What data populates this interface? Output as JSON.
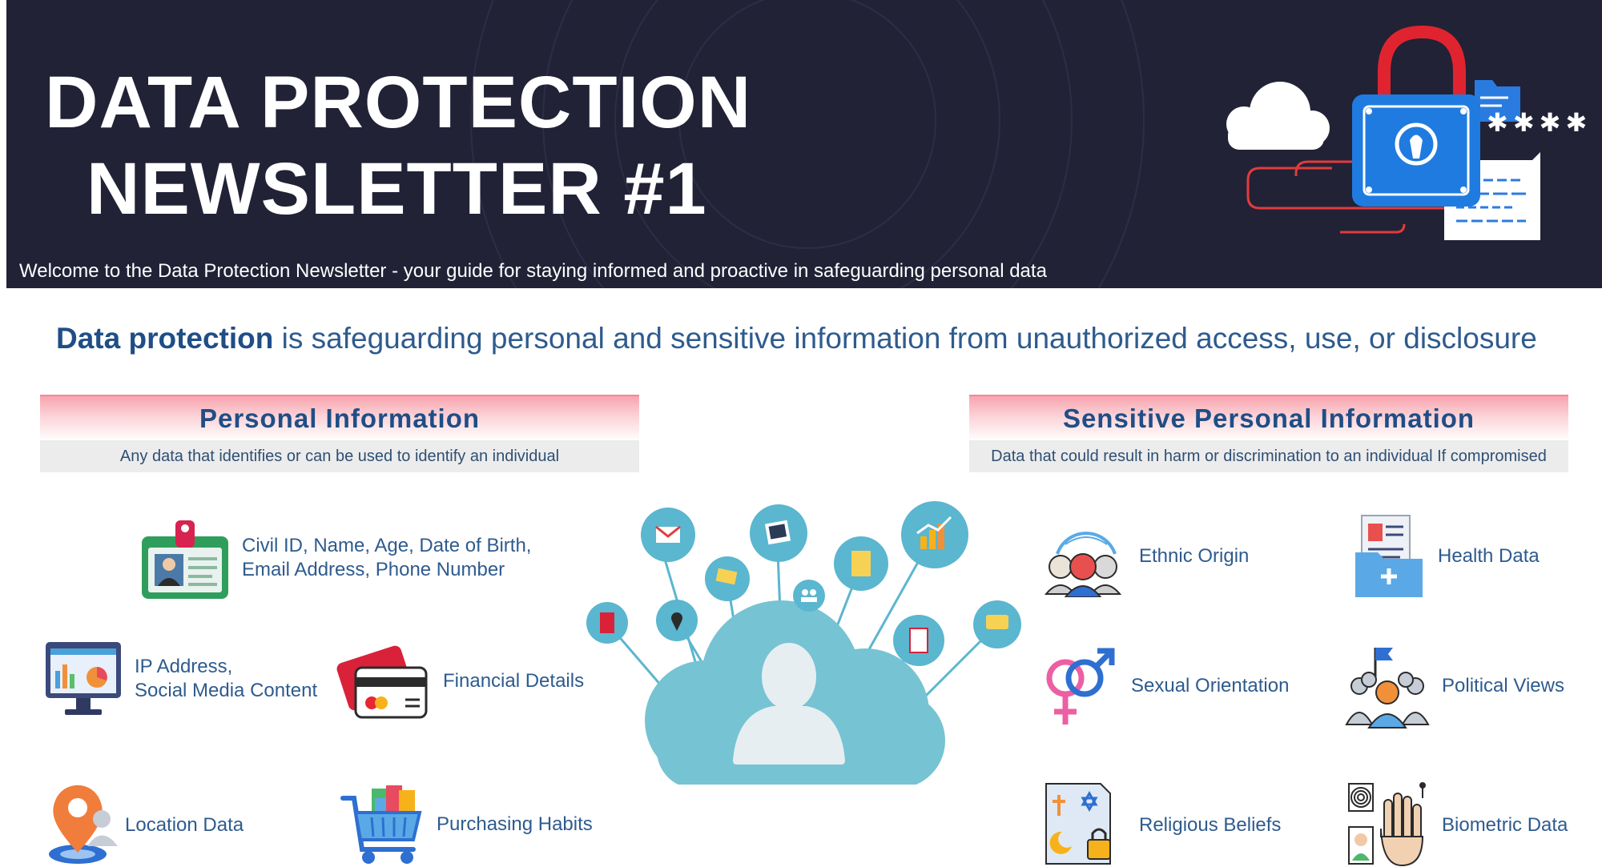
{
  "header": {
    "title_line1": "DATA PROTECTION",
    "title_line2": "NEWSLETTER #1",
    "welcome": "Welcome to the Data Protection Newsletter - your guide for staying informed and proactive in safeguarding personal data",
    "password_mask": "✱✱✱✱"
  },
  "definition": {
    "term": "Data protection",
    "text": " is safeguarding personal and sensitive information from unauthorized access, use, or disclosure"
  },
  "personal": {
    "title": "Personal Information",
    "subtitle": "Any data that identifies or can be used to identify an individual",
    "items": [
      {
        "label_line1": "Civil ID, Name, Age, Date of Birth,",
        "label_line2": "Email Address, Phone Number",
        "icon": "id-card-icon"
      },
      {
        "label_line1": "IP Address,",
        "label_line2": "Social Media Content",
        "icon": "computer-monitor-icon"
      },
      {
        "label": "Financial Details",
        "icon": "credit-card-icon"
      },
      {
        "label": "Location Data",
        "icon": "location-pin-icon"
      },
      {
        "label": "Purchasing Habits",
        "icon": "shopping-cart-icon"
      }
    ]
  },
  "sensitive": {
    "title": "Sensitive Personal Information",
    "subtitle": "Data that could result in harm or discrimination to an individual If compromised",
    "items": [
      {
        "label": "Ethnic Origin",
        "icon": "diverse-people-icon"
      },
      {
        "label": "Health Data",
        "icon": "medical-folder-icon"
      },
      {
        "label": "Sexual Orientation",
        "icon": "gender-symbols-icon"
      },
      {
        "label": "Political Views",
        "icon": "political-crowd-icon"
      },
      {
        "label": "Religious Beliefs",
        "icon": "religious-symbols-icon"
      },
      {
        "label": "Biometric Data",
        "icon": "fingerprint-hand-icon"
      }
    ]
  },
  "colors": {
    "banner": "#212236",
    "accent_blue": "#2e5b8e",
    "heading_blue": "#1f4e86",
    "pink": "#f8a4ae",
    "cloud": "#76c3d3"
  }
}
